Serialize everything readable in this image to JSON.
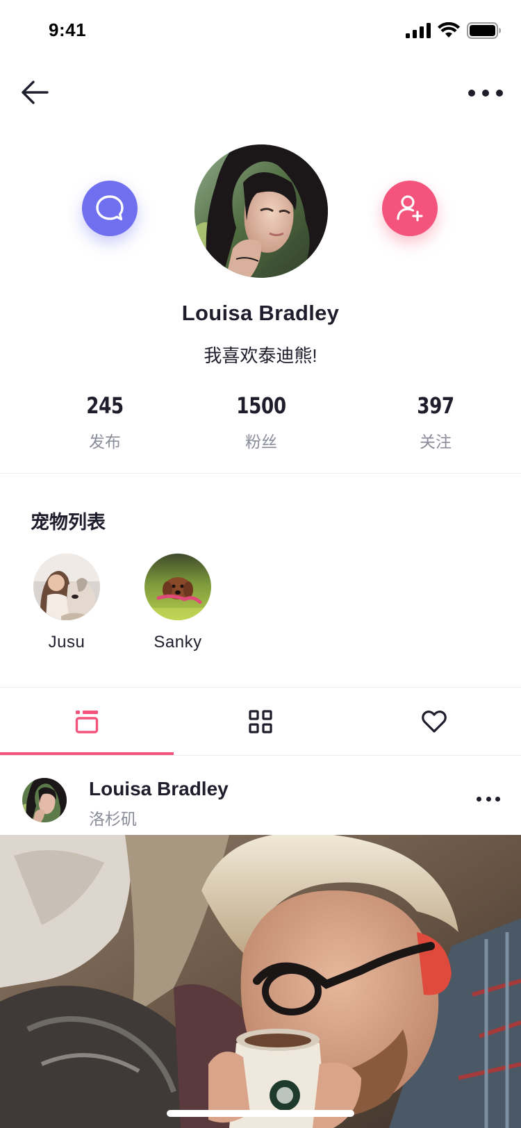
{
  "status": {
    "time": "9:41"
  },
  "nav": {
    "back_icon": "arrow-left-icon",
    "more_icon": "more-horizontal-icon"
  },
  "profile": {
    "name": "Louisa Bradley",
    "bio": "我喜欢泰迪熊!",
    "message_icon": "chat-bubble-icon",
    "follow_icon": "user-add-icon",
    "colors": {
      "message_button": "#6f6ff0",
      "follow_button": "#f4547b"
    }
  },
  "stats": [
    {
      "value": "245",
      "label": "发布"
    },
    {
      "value": "1500",
      "label": "粉丝"
    },
    {
      "value": "397",
      "label": "关注"
    }
  ],
  "pets": {
    "title": "宠物列表",
    "items": [
      {
        "name": "Jusu"
      },
      {
        "name": "Sanky"
      }
    ]
  },
  "tabs": {
    "items": [
      {
        "icon": "feed-list-icon",
        "active": true
      },
      {
        "icon": "grid-icon",
        "active": false
      },
      {
        "icon": "heart-icon",
        "active": false
      }
    ],
    "accent_color": "#f4547b"
  },
  "post": {
    "author": "Louisa Bradley",
    "location": "洛杉矶",
    "more_icon": "more-horizontal-icon"
  }
}
